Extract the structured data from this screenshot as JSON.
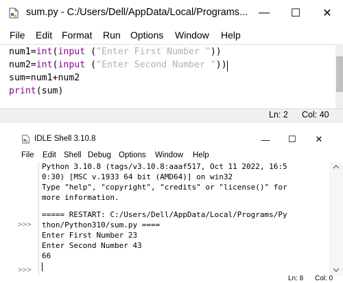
{
  "editor": {
    "title": "sum.py - C:/Users/Dell/AppData/Local/Programs...",
    "window_buttons": {
      "minimize": "—",
      "maximize": "☐",
      "close": "✕"
    },
    "menu": [
      "File",
      "Edit",
      "Format",
      "Run",
      "Options",
      "Window",
      "Help"
    ],
    "code": [
      {
        "a": "num1=",
        "b": "int",
        "c": "(",
        "d": "input",
        "e": " (",
        "f": "\"Enter First Number \"",
        "g": "))"
      },
      {
        "a": "num2=",
        "b": "int",
        "c": "(",
        "d": "input",
        "e": " (",
        "f": "\"Enter Second Number \"",
        "g": "))"
      },
      {
        "a": "sum=num1+num2",
        "b": "",
        "c": "",
        "d": "",
        "e": "",
        "f": "",
        "g": ""
      },
      {
        "a": "",
        "b": "",
        "c": "",
        "d": "print",
        "e": "(sum)",
        "f": "",
        "g": ""
      }
    ],
    "status": {
      "line": "Ln: 2",
      "col": "Col: 40"
    }
  },
  "shell": {
    "title": "IDLE Shell 3.10.8",
    "window_buttons": {
      "minimize": "—",
      "maximize": "☐",
      "close": "✕"
    },
    "menu": [
      "File",
      "Edit",
      "Shell",
      "Debug",
      "Options",
      "Window",
      "Help"
    ],
    "prompts": [
      ">>>",
      ">>>"
    ],
    "output": [
      "Python 3.10.8 (tags/v3.10.8:aaaf517, Oct 11 2022, 16:5",
      "0:30) [MSC v.1933 64 bit (AMD64)] on win32",
      "Type \"help\", \"copyright\", \"credits\" or \"license()\" for",
      "more information.",
      "",
      "===== RESTART: C:/Users/Dell/AppData/Local/Programs/Py",
      "thon/Python310/sum.py ====",
      "Enter First Number 23",
      "Enter Second Number 43",
      "66"
    ],
    "status": {
      "line": "Ln: 8",
      "col": "Col: 0"
    }
  }
}
